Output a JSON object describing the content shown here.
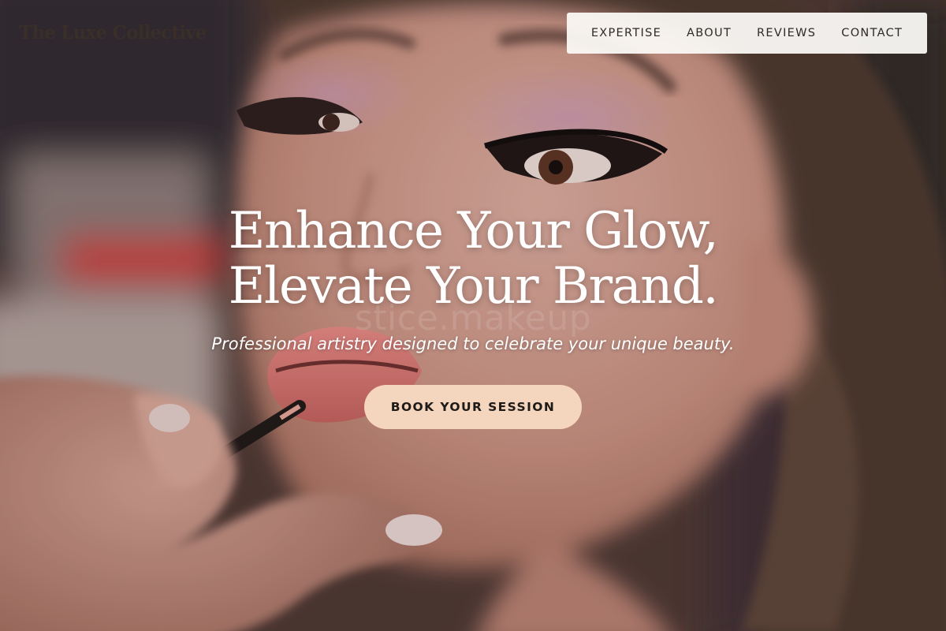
{
  "brand": {
    "name": "The Luxe Collective"
  },
  "nav": {
    "items": [
      {
        "label": "EXPERTISE"
      },
      {
        "label": "ABOUT"
      },
      {
        "label": "REVIEWS"
      },
      {
        "label": "CONTACT"
      }
    ]
  },
  "hero": {
    "heading_line1": "Enhance Your Glow,",
    "heading_line2": "Elevate Your Brand.",
    "watermark": "stice.makeup",
    "subheading": "Professional artistry designed to celebrate your unique beauty.",
    "cta_label": "BOOK YOUR SESSION",
    "image": "makeup-artist-applying-lipstick-photo"
  },
  "colors": {
    "cta_background": "#f3d6bd",
    "nav_background": "#faf8f4",
    "heading_text": "#ffffff",
    "brand_text": "#3a2e29"
  }
}
